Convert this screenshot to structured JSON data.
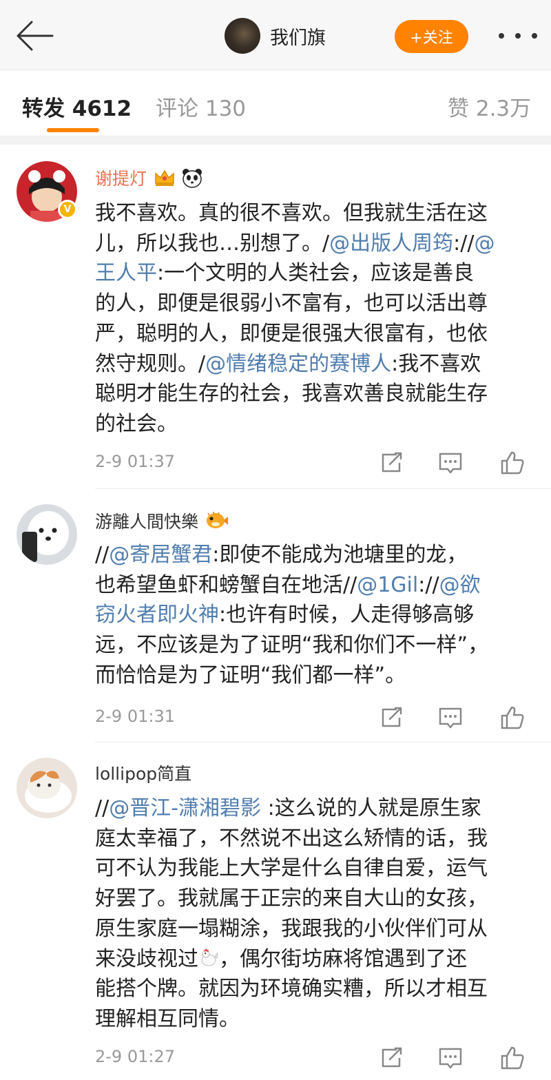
{
  "header": {
    "back_label": "back",
    "title": "我们旗",
    "follow_label": "+关注"
  },
  "tabs": {
    "repost": "转发 4612",
    "comment": "评论 130",
    "like": "赞 2.3万"
  },
  "posts": [
    {
      "username": "谢提灯",
      "username_color": "#eb7350",
      "verified": true,
      "badges": [
        "crown-icon",
        "panda-icon"
      ],
      "lines": [
        [
          {
            "t": "我不喜欢。真的很不喜欢。但我就生活在这"
          }
        ],
        [
          {
            "t": "儿，所以我也…别想了。/"
          },
          {
            "t": "@出版人周筠",
            "m": true
          },
          {
            "t": "://"
          },
          {
            "t": "@",
            "m": true
          }
        ],
        [
          {
            "t": "王人平",
            "m": true
          },
          {
            "t": ":一个文明的人类社会，应该是善良"
          }
        ],
        [
          {
            "t": "的人，即便是很弱小不富有，也可以活出尊"
          }
        ],
        [
          {
            "t": "严，聪明的人，即便是很强大很富有，也依"
          }
        ],
        [
          {
            "t": "然守规则。/"
          },
          {
            "t": "@情绪稳定的赛博人",
            "m": true
          },
          {
            "t": ":我不喜欢"
          }
        ],
        [
          {
            "t": "聪明才能生存的社会，我喜欢善良就能生存"
          }
        ],
        [
          {
            "t": "的社会。"
          }
        ]
      ],
      "time": "2-9 01:37"
    },
    {
      "username": "游離人間快樂",
      "username_color": "#333333",
      "verified": false,
      "badges": [
        "pufferfish-icon"
      ],
      "lines": [
        [
          {
            "t": "//"
          },
          {
            "t": "@寄居蟹君",
            "m": true
          },
          {
            "t": ":即使不能成为池塘里的龙，"
          }
        ],
        [
          {
            "t": "也希望鱼虾和螃蟹自在地活//"
          },
          {
            "t": "@1Gil",
            "m": true
          },
          {
            "t": "://"
          },
          {
            "t": "@欲",
            "m": true
          }
        ],
        [
          {
            "t": "窃火者即火神",
            "m": true
          },
          {
            "t": ":也许有时候，人走得够高够"
          }
        ],
        [
          {
            "t": "远，不应该是为了证明“我和你们不一样”，"
          }
        ],
        [
          {
            "t": "而恰恰是为了证明“我们都一样”。"
          }
        ]
      ],
      "time": "2-9 01:31"
    },
    {
      "username": "lollipop简直",
      "username_color": "#333333",
      "verified": false,
      "badges": [],
      "lines": [
        [
          {
            "t": "//"
          },
          {
            "t": "@晋江-潇湘碧影",
            "m": true
          },
          {
            "t": " :这么说的人就是原生家"
          }
        ],
        [
          {
            "t": "庭太幸福了，不然说不出这么矫情的话，我"
          }
        ],
        [
          {
            "t": "可不认为我能上大学是什么自律自爱，运气"
          }
        ],
        [
          {
            "t": "好罢了。我就属于正宗的来自大山的女孩，"
          }
        ],
        [
          {
            "t": "原生家庭一塌糊涂，我跟我的小伙伴们可从"
          }
        ],
        [
          {
            "t": "来没歧视过"
          },
          {
            "e": "rooster-icon"
          },
          {
            "t": "，偶尔街坊麻将馆遇到了还"
          }
        ],
        [
          {
            "t": "能搭个牌。就因为环境确实糟，所以才相互"
          }
        ],
        [
          {
            "t": "理解相互同情。"
          }
        ]
      ],
      "time": "2-9 01:27"
    }
  ],
  "colors": {
    "accent": "#ff8200",
    "mention": "#507daf",
    "muted": "#999999"
  }
}
